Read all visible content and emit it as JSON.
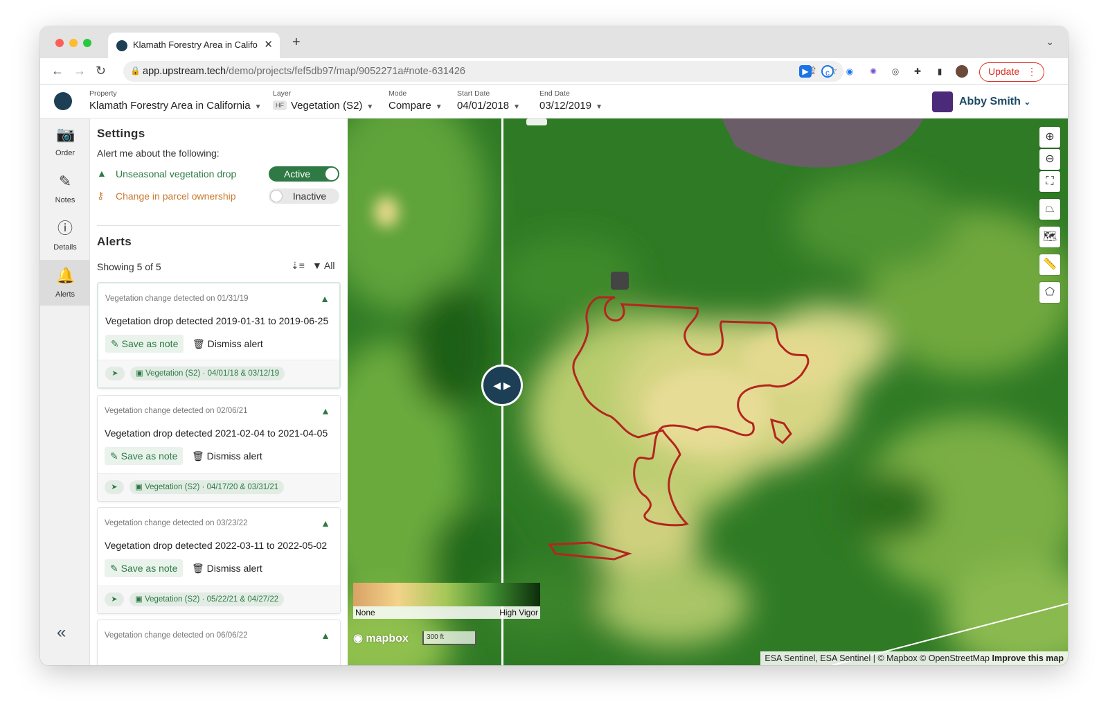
{
  "browser": {
    "tab_title": "Klamath Forestry Area in California",
    "url_host": "app.upstream.tech",
    "url_path": "/demo/projects/fef5db97/map/9052271a#note-631426",
    "update_label": "Update"
  },
  "header": {
    "property": {
      "label": "Property",
      "value": "Klamath Forestry Area in California"
    },
    "layer": {
      "label": "Layer",
      "badge": "HF",
      "value": "Vegetation (S2)"
    },
    "mode": {
      "label": "Mode",
      "value": "Compare"
    },
    "start_date": {
      "label": "Start Date",
      "value": "04/01/2018"
    },
    "end_date": {
      "label": "End Date",
      "value": "03/12/2019"
    },
    "user_name": "Abby Smith"
  },
  "rail": [
    {
      "label": "Order",
      "icon": "camera-icon"
    },
    {
      "label": "Notes",
      "icon": "note-edit-icon"
    },
    {
      "label": "Details",
      "icon": "info-icon"
    },
    {
      "label": "Alerts",
      "icon": "bell-icon",
      "active": true
    }
  ],
  "settings": {
    "title": "Settings",
    "subtitle": "Alert me about the following:",
    "rules": [
      {
        "label": "Unseasonal vegetation drop",
        "state": "Active",
        "on": true,
        "color": "#2f7a44",
        "icon": "tree-icon"
      },
      {
        "label": "Change in parcel ownership",
        "state": "Inactive",
        "on": false,
        "color": "#c9792e",
        "icon": "key-icon"
      }
    ]
  },
  "alerts": {
    "title": "Alerts",
    "count_text": "Showing 5 of 5",
    "filter_label": "All",
    "save_label": "Save as note",
    "dismiss_label": "Dismiss alert",
    "items": [
      {
        "date": "Vegetation change detected on 01/31/19",
        "text": "Vegetation drop detected 2019-01-31 to 2019-06-25",
        "layer": "Vegetation (S2) · 04/01/18 & 03/12/19"
      },
      {
        "date": "Vegetation change detected on 02/06/21",
        "text": "Vegetation drop detected 2021-02-04 to 2021-04-05",
        "layer": "Vegetation (S2) · 04/17/20 & 03/31/21"
      },
      {
        "date": "Vegetation change detected on 03/23/22",
        "text": "Vegetation drop detected 2022-03-11 to 2022-05-02",
        "layer": "Vegetation (S2) · 05/22/21 & 04/27/22"
      },
      {
        "date": "Vegetation change detected on 06/06/22"
      }
    ]
  },
  "map": {
    "legend_min": "None",
    "legend_max": "High Vigor",
    "mapbox_label": "mapbox",
    "scale_label": "300 ft",
    "attribution": "ESA Sentinel, ESA Sentinel | © Mapbox © OpenStreetMap",
    "improve_label": "Improve this map",
    "outline_color": "#b3261e"
  }
}
